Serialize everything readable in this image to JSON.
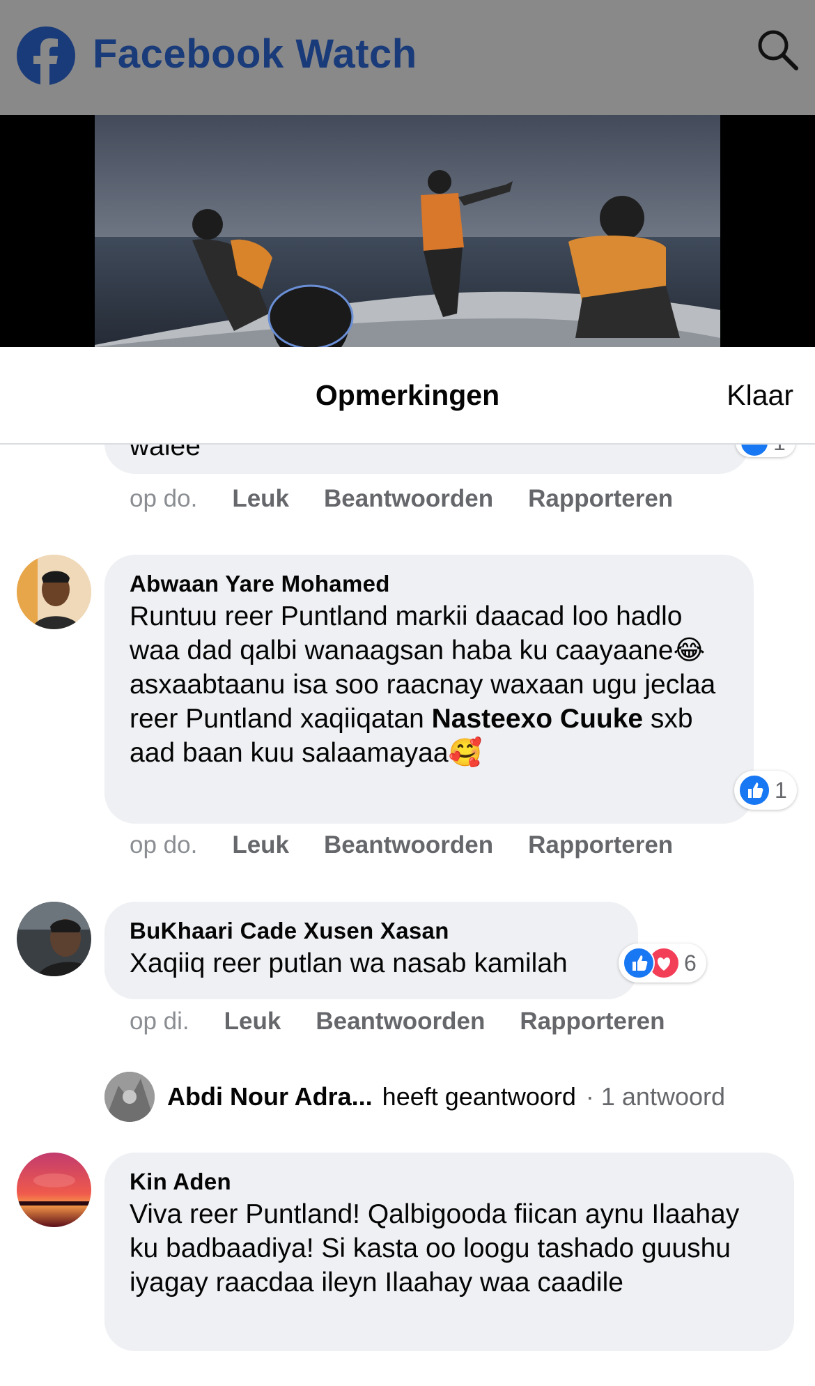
{
  "header": {
    "app_title": "Facebook Watch",
    "logo_icon": "facebook-logo-icon",
    "search_icon": "search-icon",
    "brand_color": "#1a3b79"
  },
  "sheet": {
    "title": "Opmerkingen",
    "done_label": "Klaar"
  },
  "comments": [
    {
      "text_partial": "walee",
      "time": "op do.",
      "like": "Leuk",
      "reply": "Beantwoorden",
      "report": "Rapporteren",
      "reaction_count": "1"
    },
    {
      "author": "Abwaan Yare Mohamed",
      "text_before": "Runtuu reer Puntland markii daacad loo hadlo waa dad qalbi wanaagsan haba ku caayaane😂 asxaabtaanu isa soo raacnay waxaan ugu jeclaa reer Puntland xaqiiqatan ",
      "mention": "Nasteexo Cuuke",
      "text_after": " sxb aad baan kuu salaamayaa🥰",
      "reaction_count": "1",
      "time": "op do.",
      "like": "Leuk",
      "reply": "Beantwoorden",
      "report": "Rapporteren"
    },
    {
      "author": "BuKhaari Cade Xusen Xasan",
      "text": "Xaqiiq reer putlan wa nasab kamilah",
      "reaction_count": "6",
      "time": "op di.",
      "like": "Leuk",
      "reply": "Beantwoorden",
      "report": "Rapporteren"
    },
    {
      "author": "Kin Aden",
      "text": "Viva reer Puntland! Qalbigooda fiican aynu Ilaahay ku badbaadiya! Si kasta oo loogu tashado guushu iyagay raacdaa ileyn Ilaahay waa caadile"
    }
  ],
  "reply_summary": {
    "author": "Abdi Nour Adra...",
    "verb": "heeft geantwoord",
    "count": "· 1 antwoord"
  },
  "colors": {
    "like_blue": "#1877f2",
    "love_red": "#f33e58",
    "bubble": "#eef0f3",
    "meta_gray": "#65676b"
  }
}
